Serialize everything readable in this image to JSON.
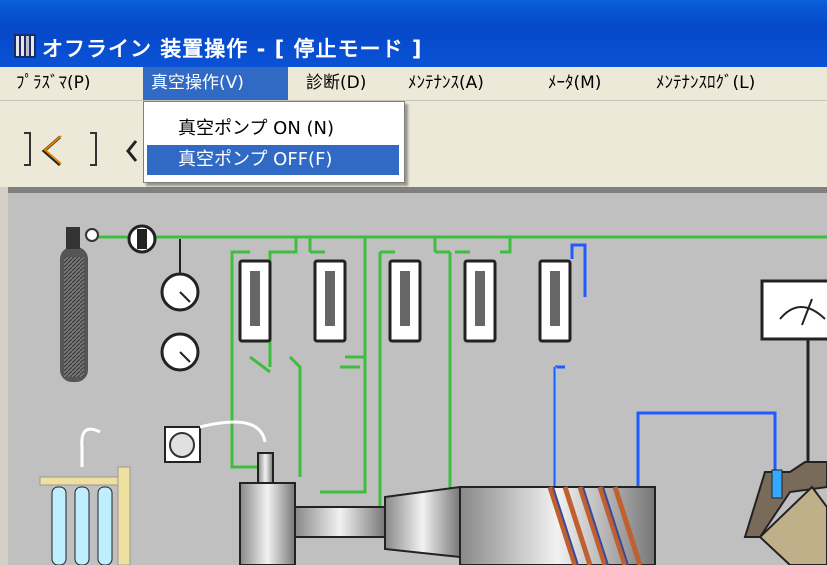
{
  "window": {
    "title": "オフライン 装置操作 - [ 停止モード ]"
  },
  "menubar": {
    "items": [
      {
        "label": "ﾌﾟﾗｽﾞﾏ(P)"
      },
      {
        "label": "真空操作(V)"
      },
      {
        "label": "診断(D)"
      },
      {
        "label": "ﾒﾝﾃﾅﾝｽ(A)"
      },
      {
        "label": "ﾒｰﾀ(M)"
      },
      {
        "label": "ﾒﾝﾃﾅﾝｽﾛｸﾞ(L)"
      }
    ]
  },
  "dropdown": {
    "items": [
      {
        "label": "真空ポンプ ON (N)"
      },
      {
        "label": "真空ポンプ OFF(F)"
      }
    ]
  },
  "colors": {
    "titlebar": "#0a52d6",
    "highlight": "#316ac5",
    "gas_line": "#3ebe3e",
    "vacuum_line": "#1e5cff",
    "canvas_bg": "#c0c0c0"
  },
  "icons": [
    "app-icon",
    "gas-cylinder-icon",
    "valve-icon",
    "pressure-gauge-icon",
    "flow-controller-icon",
    "meter-icon",
    "pump-icon",
    "test-tube-rack-icon",
    "chamber-icon"
  ]
}
